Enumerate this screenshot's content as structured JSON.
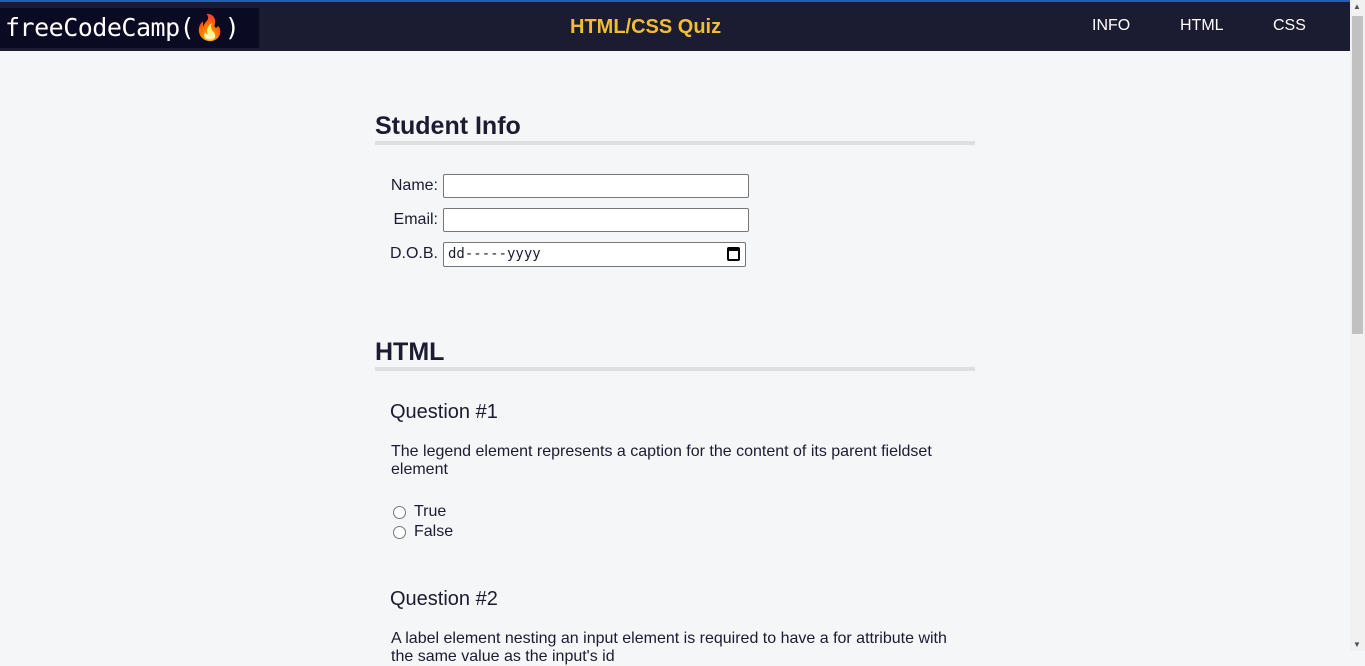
{
  "nav": {
    "logo": "freeCodeCamp(🔥)",
    "title": "HTML/CSS Quiz",
    "links": [
      "INFO",
      "HTML",
      "CSS"
    ]
  },
  "student": {
    "heading": "Student Info",
    "name_label": "Name:",
    "email_label": "Email:",
    "dob_label": "D.O.B.",
    "dob_placeholder": "dd-----yyyy"
  },
  "html": {
    "heading": "HTML",
    "questions": [
      {
        "title": "Question #1",
        "text": "The legend element represents a caption for the content of its parent fieldset element",
        "options": [
          "True",
          "False"
        ]
      },
      {
        "title": "Question #2",
        "text": "A label element nesting an input element is required to have a for attribute with the same value as the input's id"
      }
    ]
  }
}
